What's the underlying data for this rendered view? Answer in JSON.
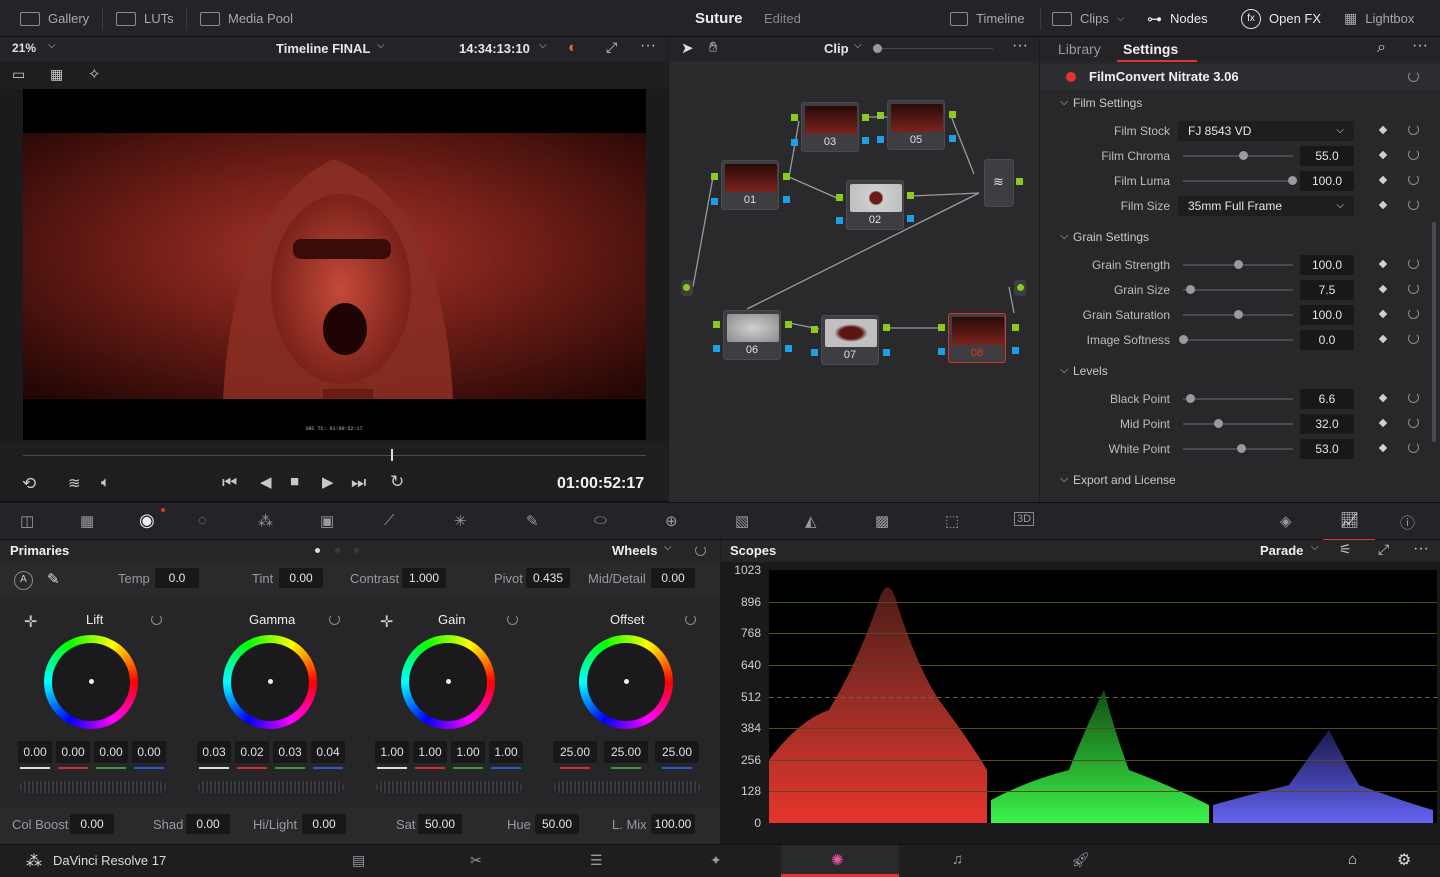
{
  "topbar": {
    "gallery": "Gallery",
    "luts": "LUTs",
    "media_pool": "Media Pool",
    "project": "Suture",
    "project_status": "Edited",
    "timeline": "Timeline",
    "clips": "Clips",
    "nodes": "Nodes",
    "openfx": "Open FX",
    "lightbox": "Lightbox"
  },
  "viewer": {
    "zoom": "21%",
    "timeline_name": "Timeline FINAL",
    "source_tc": "14:34:13:10",
    "burn_tc": "SRC TC: 01:00:52:17",
    "record_tc": "01:00:52:17",
    "scrub_progress": 0.59
  },
  "nodebar": {
    "mode": "Clip"
  },
  "nodes": [
    {
      "id": "01",
      "label": "01"
    },
    {
      "id": "02",
      "label": "02"
    },
    {
      "id": "03",
      "label": "03"
    },
    {
      "id": "05",
      "label": "05"
    },
    {
      "id": "06",
      "label": "06"
    },
    {
      "id": "07",
      "label": "07"
    },
    {
      "id": "08",
      "label": "08"
    }
  ],
  "right": {
    "tab_library": "Library",
    "tab_settings": "Settings",
    "plugin": "FilmConvert Nitrate 3.06",
    "film_settings": "Film Settings",
    "film_stock_label": "Film Stock",
    "film_stock": "FJ 8543 VD",
    "film_chroma_label": "Film Chroma",
    "film_chroma": "55.0",
    "film_luma_label": "Film Luma",
    "film_luma": "100.0",
    "film_size_label": "Film Size",
    "film_size": "35mm Full Frame",
    "grain_settings": "Grain Settings",
    "grain_strength_label": "Grain Strength",
    "grain_strength": "100.0",
    "grain_size_label": "Grain Size",
    "grain_size": "7.5",
    "grain_saturation_label": "Grain Saturation",
    "grain_saturation": "100.0",
    "image_softness_label": "Image Softness",
    "image_softness": "0.0",
    "levels": "Levels",
    "black_point_label": "Black Point",
    "black_point": "6.6",
    "mid_point_label": "Mid Point",
    "mid_point": "32.0",
    "white_point_label": "White Point",
    "white_point": "53.0",
    "export_license": "Export and License"
  },
  "primaries": {
    "title": "Primaries",
    "mode": "Wheels",
    "temp_label": "Temp",
    "temp": "0.0",
    "tint_label": "Tint",
    "tint": "0.00",
    "contrast_label": "Contrast",
    "contrast": "1.000",
    "pivot_label": "Pivot",
    "pivot": "0.435",
    "middetail_label": "Mid/Detail",
    "middetail": "0.00",
    "lift_label": "Lift",
    "lift": [
      "0.00",
      "0.00",
      "0.00",
      "0.00"
    ],
    "gamma_label": "Gamma",
    "gamma": [
      "0.03",
      "0.02",
      "0.03",
      "0.04"
    ],
    "gain_label": "Gain",
    "gain": [
      "1.00",
      "1.00",
      "1.00",
      "1.00"
    ],
    "offset_label": "Offset",
    "offset": [
      "25.00",
      "25.00",
      "25.00"
    ],
    "colboost_label": "Col Boost",
    "colboost": "0.00",
    "shad_label": "Shad",
    "shad": "0.00",
    "hilight_label": "Hi/Light",
    "hilight": "0.00",
    "sat_label": "Sat",
    "sat": "50.00",
    "hue_label": "Hue",
    "hue": "50.00",
    "lmix_label": "L. Mix",
    "lmix": "100.00"
  },
  "scopes": {
    "title": "Scopes",
    "mode": "Parade",
    "ticks": [
      "1023",
      "896",
      "768",
      "640",
      "512",
      "384",
      "256",
      "128",
      "0"
    ]
  },
  "footer": {
    "app": "DaVinci Resolve 17"
  },
  "colors": {
    "accent_red": "#e0352b",
    "green_port": "#8acb1f",
    "blue_port": "#1ba0e6"
  }
}
